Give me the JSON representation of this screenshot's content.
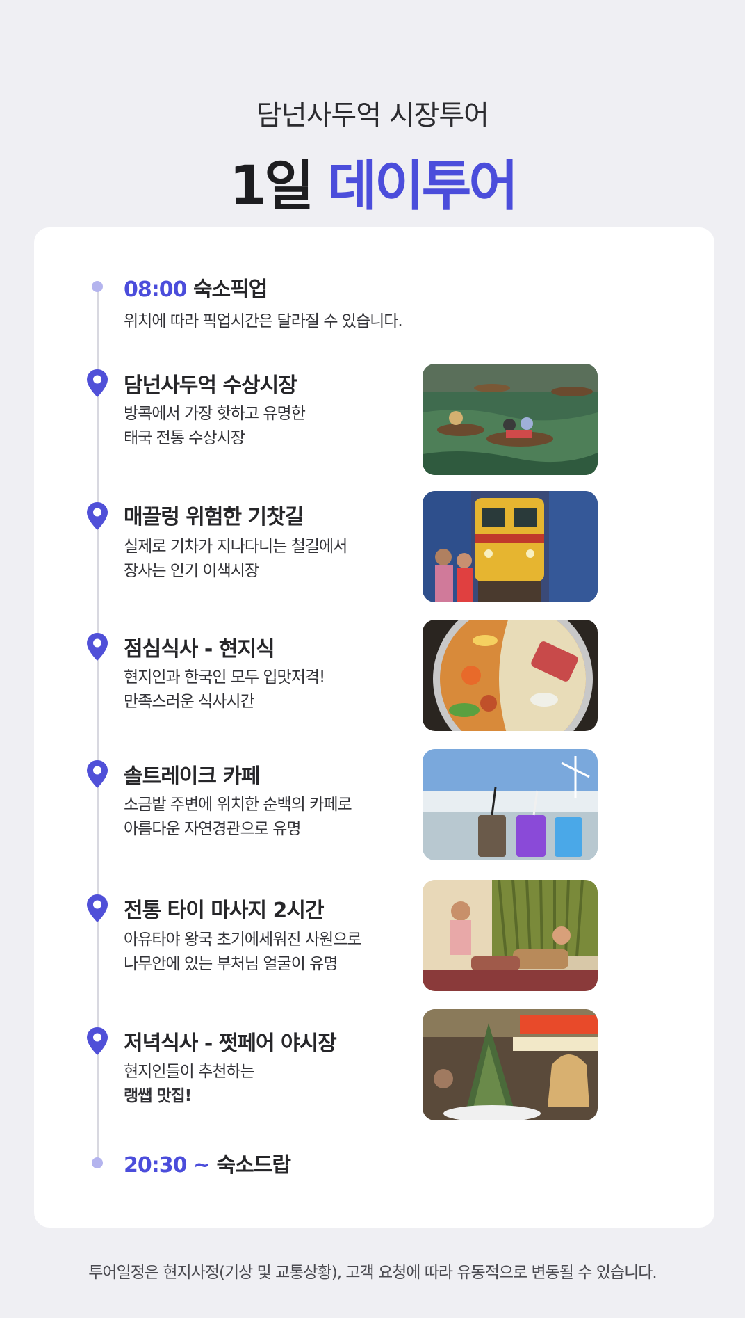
{
  "header": {
    "subtitle": "담넌사두억 시장투어",
    "title_dark": "1일",
    "title_accent": "데이투어"
  },
  "pickup": {
    "time": "08:00",
    "label": "숙소픽업",
    "note": "위치에 따라 픽업시간은 달라질 수 있습니다."
  },
  "stops": [
    {
      "title": "담넌사두억 수상시장",
      "desc": [
        "방콕에서 가장 핫하고 유명한",
        "태국 전통 수상시장"
      ]
    },
    {
      "title": "매끌렁 위험한 기찻길",
      "desc": [
        "실제로 기차가 지나다니는 철길에서",
        "장사는 인기 이색시장"
      ]
    },
    {
      "title": "점심식사 - 현지식",
      "desc": [
        "현지인과 한국인 모두 입맛저격!",
        "만족스러운 식사시간"
      ]
    },
    {
      "title": "솔트레이크 카페",
      "desc": [
        "소금밭 주변에 위치한 순백의 카페로",
        "아름다운 자연경관으로 유명"
      ]
    },
    {
      "title": "전통 타이 마사지 2시간",
      "desc": [
        "아유타야 왕국 초기에세워진 사원으로",
        "나무안에 있는 부처님 얼굴이 유명"
      ]
    },
    {
      "title": "저녁식사 - 쩟페어 야시장",
      "desc": [
        "현지인들이 추천하는",
        "랭쌥 맛집!"
      ]
    }
  ],
  "dropoff": {
    "time": "20:30 ~",
    "label": "숙소드랍"
  },
  "footer_note": "투어일정은 현지사정(기상 및 교통상황), 고객 요청에 따라 유동적으로 변동될 수 있습니다.",
  "colors": {
    "accent": "#4b4ddb",
    "pin": "#5050d8",
    "dot": "#b4b4ee",
    "background": "#efeff3"
  },
  "icons": {
    "stop_marker": "location-pin-icon",
    "time_marker": "timeline-dot-icon"
  }
}
